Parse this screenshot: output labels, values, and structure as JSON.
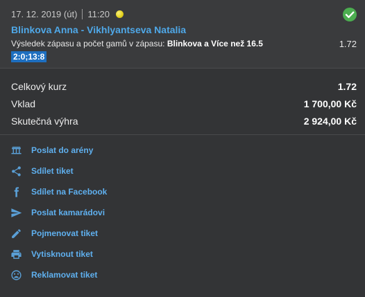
{
  "bet": {
    "date": "17. 12. 2019 (út)",
    "time": "11:20",
    "match": "Blinkova Anna - Vikhlyantseva Natalia",
    "market_prefix": "Výsledek zápasu a počet gamů v zápasu: ",
    "selection": "Blinkova a Více než 16.5",
    "odd": "1.72",
    "score": "2:0;13:8"
  },
  "summary": {
    "total_odds_label": "Celkový kurz",
    "total_odds_value": "1.72",
    "stake_label": "Vklad",
    "stake_value": "1 700,00 Kč",
    "win_label": "Skutečná výhra",
    "win_value": "2 924,00 Kč"
  },
  "actions": [
    {
      "label": "Poslat do arény",
      "icon": "arena-icon"
    },
    {
      "label": "Sdílet tiket",
      "icon": "share-icon"
    },
    {
      "label": "Sdílet na Facebook",
      "icon": "facebook-icon"
    },
    {
      "label": "Poslat kamarádovi",
      "icon": "send-icon"
    },
    {
      "label": "Pojmenovat tiket",
      "icon": "pencil-icon"
    },
    {
      "label": "Vytisknout tiket",
      "icon": "print-icon"
    },
    {
      "label": "Reklamovat tiket",
      "icon": "sad-face-icon"
    }
  ],
  "colors": {
    "link": "#5fb0ef",
    "match_title": "#4fa8e8",
    "success": "#4cae50",
    "score_badge": "#1e6fc0"
  }
}
